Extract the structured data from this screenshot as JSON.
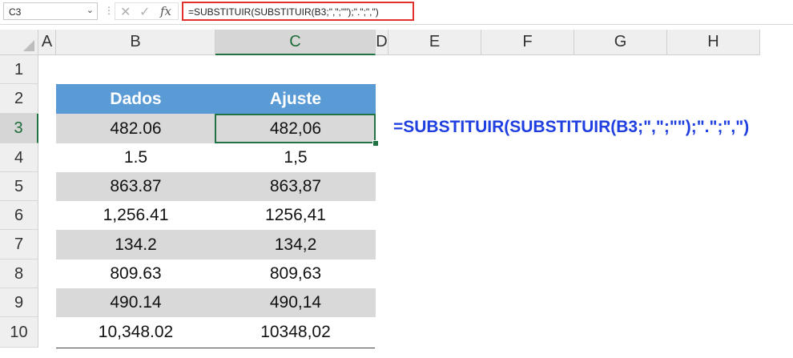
{
  "formula_bar": {
    "name_box": "C3",
    "formula": "=SUBSTITUIR(SUBSTITUIR(B3;\",\";\"\");\".\";\",\")",
    "icons": [
      "chevron-down-icon",
      "cancel-icon",
      "check-icon",
      "fx-icon"
    ]
  },
  "columns": [
    "A",
    "B",
    "C",
    "D",
    "E",
    "F",
    "G",
    "H"
  ],
  "rows": [
    "1",
    "2",
    "3",
    "4",
    "5",
    "6",
    "7",
    "8",
    "9",
    "10"
  ],
  "selected_cell": "C3",
  "table": {
    "headers": [
      "Dados",
      "Ajuste"
    ],
    "rows": [
      [
        "482.06",
        "482,06"
      ],
      [
        "1.5",
        "1,5"
      ],
      [
        "863.87",
        "863,87"
      ],
      [
        "1,256.41",
        "1256,41"
      ],
      [
        "134.2",
        "134,2"
      ],
      [
        "809.63",
        "809,63"
      ],
      [
        "490.14",
        "490,14"
      ],
      [
        "10,348.02",
        "10348,02"
      ]
    ]
  },
  "annotation": "=SUBSTITUIR(SUBSTITUIR(B3;\",\";\"\");\".\";\",\")",
  "colors": {
    "header": "#5b9bd5",
    "band": "#d9d9d9",
    "selection": "#217346",
    "annotation": "#1f3fe0",
    "highlight_border": "#e0322b"
  }
}
